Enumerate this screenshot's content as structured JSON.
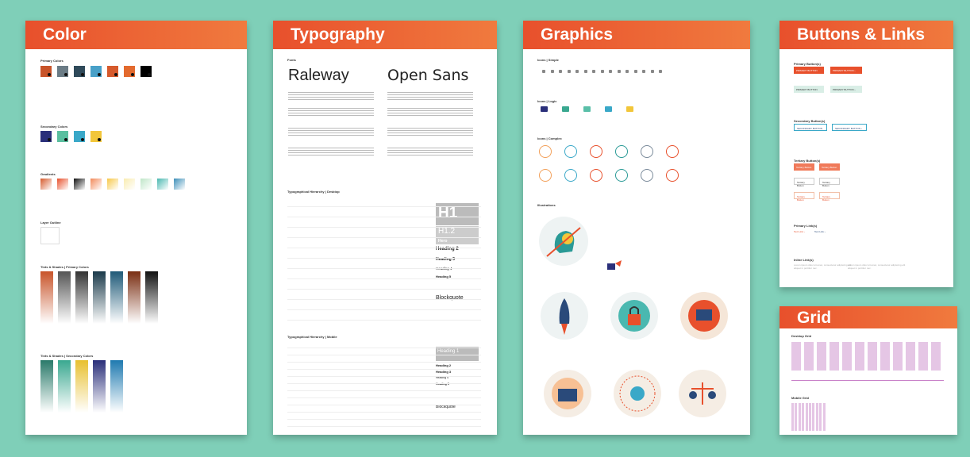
{
  "cards": {
    "color": "Color",
    "typography": "Typography",
    "graphics": "Graphics",
    "buttons": "Buttons & Links",
    "grid": "Grid"
  },
  "typography": {
    "font1": "Raleway",
    "font2": "Open Sans",
    "h1": "H1",
    "h12": "H1.2",
    "hero": "Hero",
    "h2": "Heading 2",
    "h3": "Heading 3",
    "h4": "Heading 4",
    "h5": "Heading 5",
    "blockquote": "Blockquote",
    "m_h1": "Heading 1",
    "m_h2": "Heading 2",
    "m_h3": "Heading 3",
    "m_h4": "Heading 4",
    "m_h5": "Heading 5",
    "m_blockquote": "Blockquote"
  },
  "colors": {
    "primary": [
      "#c8542a",
      "#6b7c86",
      "#2f4a5a",
      "#48a0c8",
      "#d65a2c",
      "#e36a2e",
      "#000000"
    ],
    "secondary": [
      "#2a2f7a",
      "#5abf9f",
      "#3aa8c8",
      "#f2c63a"
    ],
    "gradients": [
      "#d65a2c",
      "#e8502c",
      "#111111",
      "#f28a5a",
      "#f7c94a",
      "#f9ecb0",
      "#bfe6c8",
      "#4ab8b0",
      "#3d8fb8"
    ],
    "tints_primary": [
      "#c8542a",
      "#555555",
      "#333333",
      "#1a3a4a",
      "#1f5a78",
      "#7a2e12",
      "#111111"
    ],
    "tints_secondary": [
      "#2a7a6a",
      "#3aa890",
      "#e8c030",
      "#2a2f7a",
      "#1f7ab0"
    ]
  }
}
